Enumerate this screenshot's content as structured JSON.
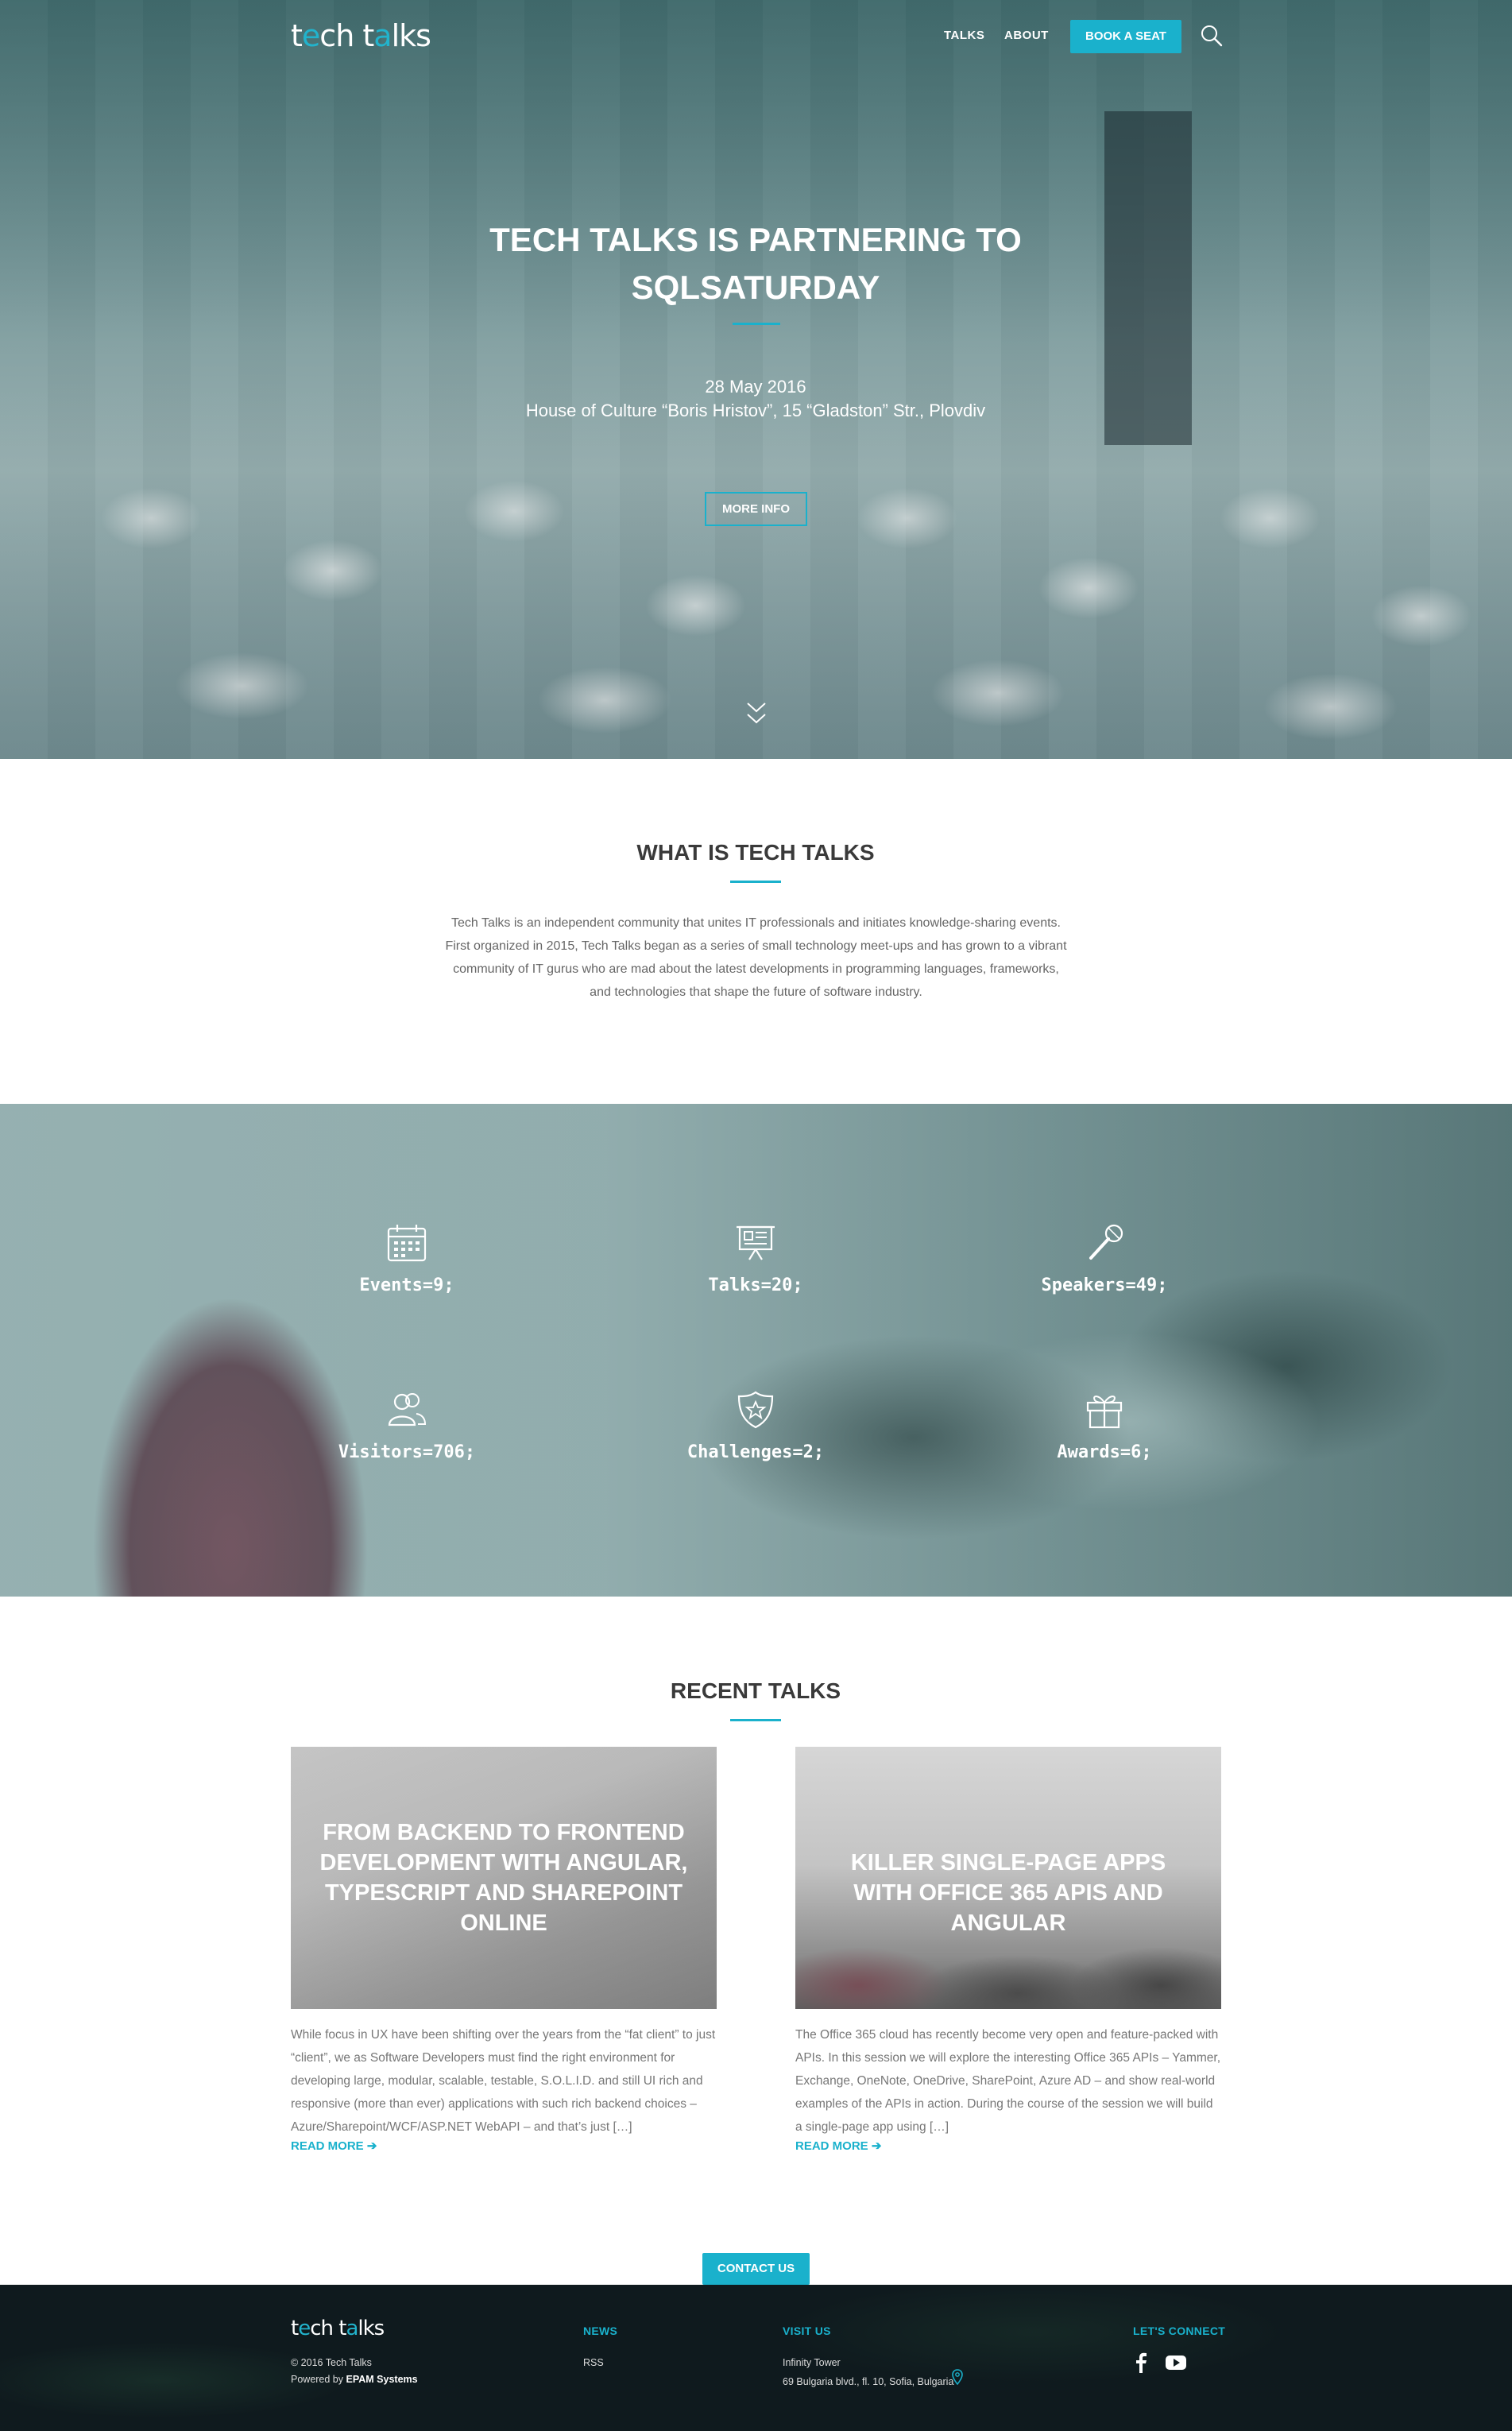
{
  "header": {
    "logo_prefix": "t",
    "logo_accent": "e",
    "logo_mid": "ch t",
    "logo_accent2": "a",
    "logo_suffix": "lks",
    "nav": [
      "TALKS",
      "ABOUT"
    ],
    "book_label": "BOOK A SEAT"
  },
  "hero": {
    "title": "TECH TALKS IS PARTNERING TO SQLSATURDAY",
    "date": "28 May 2016",
    "venue": "House of Culture “Boris Hristov”, 15 “Gladston” Str., Plovdiv",
    "more_label": "MORE INFO"
  },
  "about": {
    "title": "WHAT IS TECH TALKS",
    "text": "Tech Talks is an independent community that unites IT professionals and initiates knowledge-sharing events. First organized in 2015, Tech Talks began as a series of small technology meet-ups and has grown to a vibrant community of IT gurus who are mad about the latest developments in programming languages, frameworks, and technologies that shape the future of software industry."
  },
  "stats": [
    {
      "icon": "calendar-icon",
      "label": "Events=9;"
    },
    {
      "icon": "presentation-icon",
      "label": "Talks=20;"
    },
    {
      "icon": "microphone-icon",
      "label": "Speakers=49;"
    },
    {
      "icon": "people-icon",
      "label": "Visitors=706;"
    },
    {
      "icon": "shield-star-icon",
      "label": "Challenges=2;"
    },
    {
      "icon": "gift-icon",
      "label": "Awards=6;"
    }
  ],
  "recent": {
    "title": "RECENT TALKS",
    "cards": [
      {
        "title": "FROM BACKEND TO FRONTEND DEVELOPMENT WITH ANGULAR, TYPESCRIPT AND SHAREPOINT ONLINE",
        "text": "While focus in UX have been shifting over the years from the “fat client” to just “client”, we as Software Developers must find the right environment for developing large, modular, scalable, testable, S.O.L.I.D. and still UI rich and responsive (more than ever) applications with such rich backend choices – Azure/Sharepoint/WCF/ASP.NET WebAPI – and that’s just […]",
        "read_more": "READ MORE"
      },
      {
        "title": "KILLER SINGLE-PAGE APPS WITH OFFICE 365 APIS AND ANGULAR",
        "text": "The Office 365 cloud has recently become very open and feature-packed with APIs. In this session we will explore the interesting Office 365 APIs – Yammer, Exchange, OneNote, OneDrive, SharePoint, Azure AD – and show real-world examples of the APIs in action. During the course of the session we will build a single-page app using […]",
        "read_more": "READ MORE"
      }
    ]
  },
  "contact_label": "CONTACT US",
  "footer": {
    "copyright": "© 2016 Tech Talks",
    "powered_prefix": "Powered by",
    "powered_by": "EPAM Systems",
    "news_head": "NEWS",
    "news_items": [
      "RSS"
    ],
    "visit_head": "VISIT US",
    "visit_name": "Infinity Tower",
    "visit_address": "69 Bulgaria blvd., fl. 10, Sofia, Bulgaria",
    "connect_head": "LET'S CONNECT"
  },
  "colors": {
    "accent": "#1ab1cc",
    "footer_bg": "#0f1a1e",
    "heading": "#3a3a3a"
  }
}
